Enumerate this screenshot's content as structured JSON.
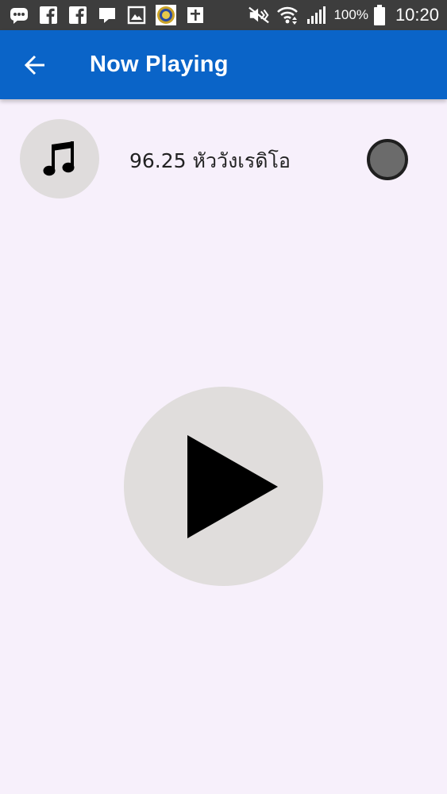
{
  "status_bar": {
    "battery_text": "100%",
    "time": "10:20",
    "icons": [
      "messenger-icon",
      "facebook-icon",
      "facebook-icon",
      "chat-icon",
      "gallery-icon",
      "app-logo-icon",
      "calendar-icon",
      "mute-icon",
      "wifi-icon",
      "signal-icon",
      "battery-icon"
    ]
  },
  "app_bar": {
    "title": "Now Playing",
    "back_icon": "arrow-left-icon",
    "background_color": "#0a64c8"
  },
  "station": {
    "name": "96.25 หัววังเรดิโอ",
    "avatar_icon": "music-note-icon",
    "indicator_color": "#6b6b6b"
  },
  "player": {
    "play_icon": "play-icon"
  }
}
